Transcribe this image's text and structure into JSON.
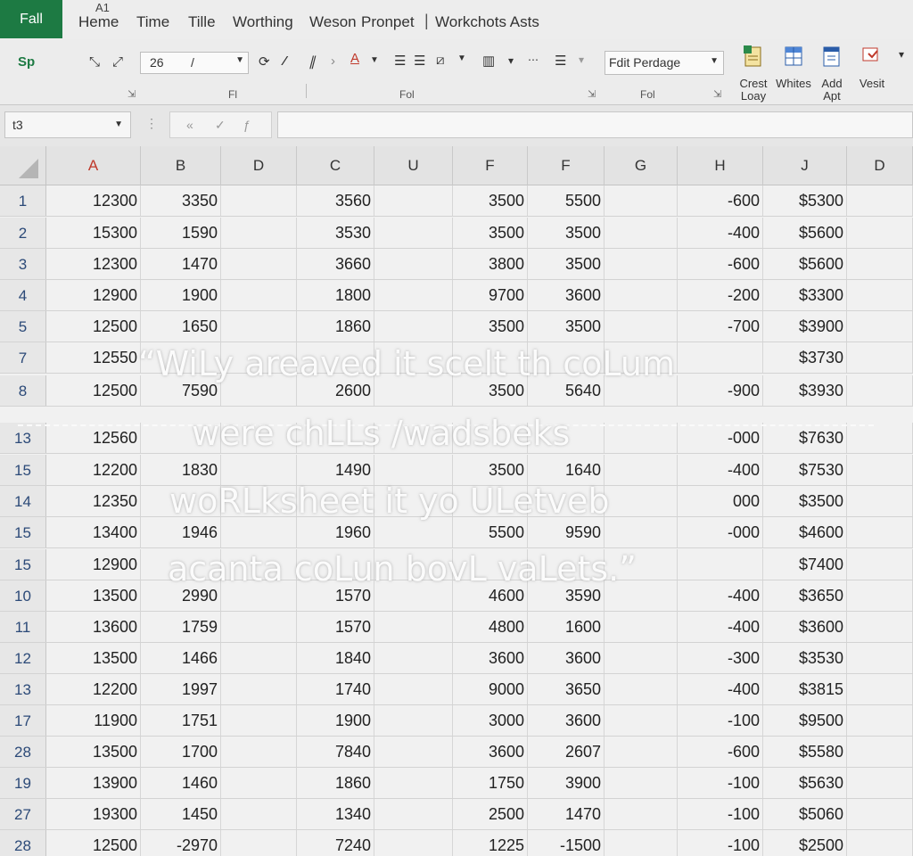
{
  "ribbon": {
    "file_tab": "Fall",
    "home_key": "A1",
    "tabs": [
      "Heme",
      "Time",
      "Tille",
      "Worthing",
      "Weson",
      "Pronpet",
      "|",
      "Workchots Asts"
    ],
    "tab_separator": "|",
    "clipboard_label": "Sp",
    "font_size": "26",
    "font_size_slash": "/",
    "style_select": "Fdit Perdage",
    "group_labels": [
      "Fl",
      "Fol",
      "Fol"
    ],
    "buttons": {
      "crest": "Crest Loay",
      "whites": "Whites",
      "add": "Add Apt",
      "vesit": "Vesit"
    }
  },
  "formula_bar": {
    "name_box": "t3",
    "formula": ""
  },
  "grid": {
    "columns": [
      "A",
      "B",
      "D",
      "C",
      "U",
      "F",
      "F",
      "G",
      "H",
      "J",
      "D"
    ],
    "rows": [
      {
        "n": "1",
        "cells": [
          "12300",
          "3350",
          "",
          "3560",
          "",
          "3500",
          "5500",
          "",
          "-600",
          "$5300",
          ""
        ]
      },
      {
        "n": "2",
        "cells": [
          "15300",
          "1590",
          "",
          "3530",
          "",
          "3500",
          "3500",
          "",
          "-400",
          "$5600",
          ""
        ]
      },
      {
        "n": "3",
        "cells": [
          "12300",
          "1470",
          "",
          "3660",
          "",
          "3800",
          "3500",
          "",
          "-600",
          "$5600",
          ""
        ]
      },
      {
        "n": "4",
        "cells": [
          "12900",
          "1900",
          "",
          "1800",
          "",
          "9700",
          "3600",
          "",
          "-200",
          "$3300",
          ""
        ]
      },
      {
        "n": "5",
        "cells": [
          "12500",
          "1650",
          "",
          "1860",
          "",
          "3500",
          "3500",
          "",
          "-700",
          "$3900",
          ""
        ]
      },
      {
        "n": "7",
        "cells": [
          "12550",
          "",
          "",
          "",
          "",
          "",
          "",
          "",
          "",
          "$3730",
          ""
        ]
      },
      {
        "n": "8",
        "cells": [
          "12500",
          "7590",
          "",
          "2600",
          "",
          "3500",
          "5640",
          "",
          "-900",
          "$3930",
          ""
        ]
      },
      {
        "n": "13",
        "cells": [
          "12560",
          "",
          "",
          "",
          "",
          "",
          "",
          "",
          "-000",
          "$7630",
          ""
        ]
      },
      {
        "n": "15",
        "cells": [
          "12200",
          "1830",
          "",
          "1490",
          "",
          "3500",
          "1640",
          "",
          "-400",
          "$7530",
          ""
        ]
      },
      {
        "n": "14",
        "cells": [
          "12350",
          "",
          "",
          "",
          "",
          "",
          "",
          "",
          "000",
          "$3500",
          ""
        ]
      },
      {
        "n": "15",
        "cells": [
          "13400",
          "1946",
          "",
          "1960",
          "",
          "5500",
          "9590",
          "",
          "-000",
          "$4600",
          ""
        ]
      },
      {
        "n": "15",
        "cells": [
          "12900",
          "",
          "",
          "",
          "",
          "",
          "",
          "",
          "",
          "$7400",
          ""
        ]
      },
      {
        "n": "10",
        "cells": [
          "13500",
          "2990",
          "",
          "1570",
          "",
          "4600",
          "3590",
          "",
          "-400",
          "$3650",
          ""
        ]
      },
      {
        "n": "11",
        "cells": [
          "13600",
          "1759",
          "",
          "1570",
          "",
          "4800",
          "1600",
          "",
          "-400",
          "$3600",
          ""
        ]
      },
      {
        "n": "12",
        "cells": [
          "13500",
          "1466",
          "",
          "1840",
          "",
          "3600",
          "3600",
          "",
          "-300",
          "$3530",
          ""
        ]
      },
      {
        "n": "13",
        "cells": [
          "12200",
          "1997",
          "",
          "1740",
          "",
          "9000",
          "3650",
          "",
          "-400",
          "$3815",
          ""
        ]
      },
      {
        "n": "17",
        "cells": [
          "11900",
          "1751",
          "",
          "1900",
          "",
          "3000",
          "3600",
          "",
          "-100",
          "$9500",
          ""
        ]
      },
      {
        "n": "28",
        "cells": [
          "13500",
          "1700",
          "",
          "7840",
          "",
          "3600",
          "2607",
          "",
          "-600",
          "$5580",
          ""
        ]
      },
      {
        "n": "19",
        "cells": [
          "13900",
          "1460",
          "",
          "1860",
          "",
          "1750",
          "3900",
          "",
          "-100",
          "$5630",
          ""
        ]
      },
      {
        "n": "27",
        "cells": [
          "19300",
          "1450",
          "",
          "1340",
          "",
          "2500",
          "1470",
          "",
          "-100",
          "$5060",
          ""
        ]
      },
      {
        "n": "28",
        "cells": [
          "12500",
          "-2970",
          "",
          "7240",
          "",
          "1225",
          "-1500",
          "",
          "-100",
          "$2500",
          ""
        ]
      }
    ]
  },
  "overlay": {
    "lines": [
      "“WiLy areaved it  scelt th coLum",
      "were chLLs /wadsbeks",
      "woRLksheet  it  yo ULetveb",
      "acanta coLun bovL vaLets.”"
    ]
  },
  "colors": {
    "file_tab_bg": "#1d7a43",
    "row_header_text": "#2c4a78",
    "column_a_header": "#c0392b"
  }
}
